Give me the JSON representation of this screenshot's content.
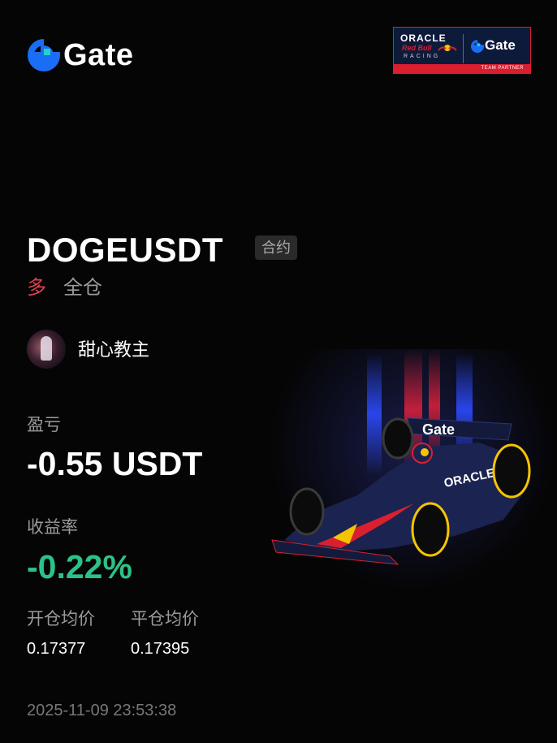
{
  "brand": {
    "logo_text": "Gate",
    "accent": "#1a6ef5",
    "accent_secondary": "#21d3c8"
  },
  "partner_badge": {
    "sponsor": "ORACLE",
    "team_line1": "Red Bull",
    "team_line2": "RACING",
    "partner_logo_text": "Gate",
    "caption": "TEAM PARTNER"
  },
  "position": {
    "symbol": "DOGEUSDT",
    "contract_type": "合约",
    "direction": "多",
    "margin_mode": "全仓",
    "direction_color": "#e0414f"
  },
  "user": {
    "name": "甜心教主",
    "avatar_icon": "avatar-icon"
  },
  "pnl": {
    "label": "盈亏",
    "value": "-0.55 USDT"
  },
  "roi": {
    "label": "收益率",
    "value": "-0.22%",
    "color": "#2bc287"
  },
  "prices": {
    "open_label": "开仓均价",
    "open_value": "0.17377",
    "close_label": "平仓均价",
    "close_value": "0.17395"
  },
  "timestamp": "2025-11-09 23:53:38",
  "illustration": {
    "car_livery_text": "Gate",
    "car_sponsor_text": "ORACLE"
  }
}
